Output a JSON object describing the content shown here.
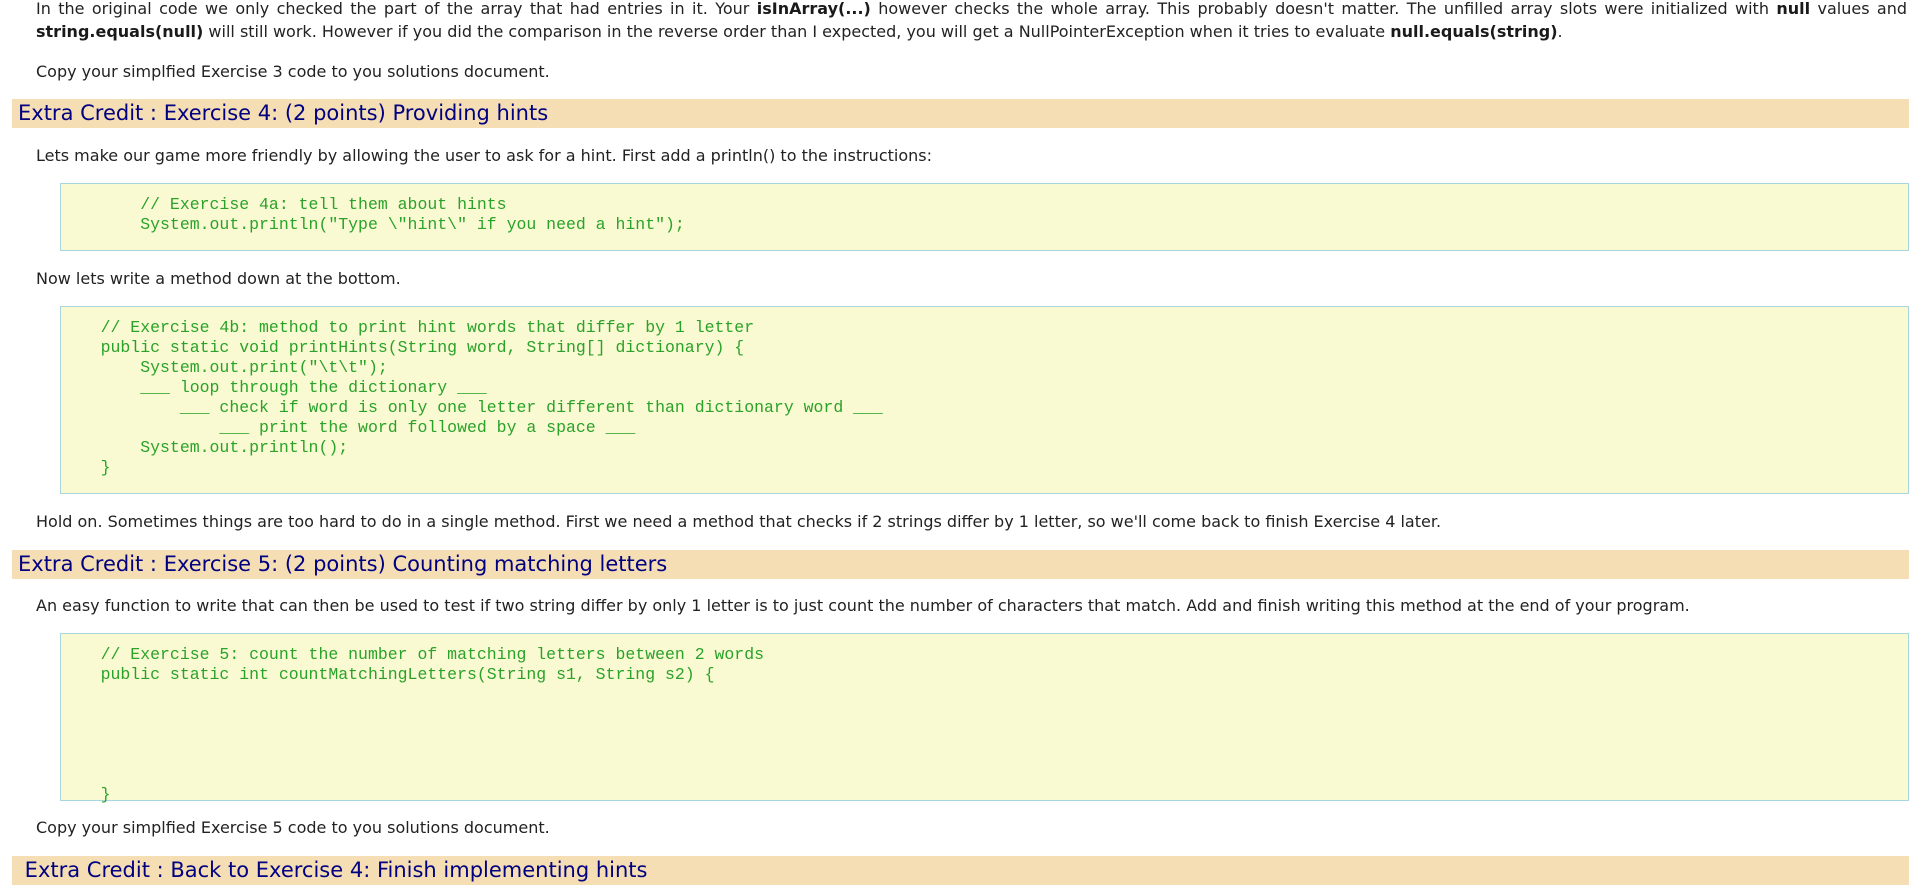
{
  "intro": {
    "p1_part1": "In the original code we only checked the part of the array that had entries in it. Your ",
    "p1_bold1": "isInArray(...)",
    "p1_part2": " however checks the whole array. This probably doesn't matter. The unfilled array slots were initialized with ",
    "p1_bold2": "null",
    "p1_part3": " values and ",
    "p1_bold3": "string.equals(null)",
    "p1_part4": " will still work. However if you did the comparison in the reverse order than I expected, you will get a NullPointerException when it tries to evaluate ",
    "p1_bold4": "null.equals(string)",
    "p1_part5": ".",
    "p2": "Copy your simplfied Exercise 3 code to you solutions document."
  },
  "exercise4": {
    "heading": "Extra Credit : Exercise 4: (2 points) Providing hints",
    "p1": "Lets make our game more friendly by allowing the user to ask for a hint. First add a println() to the instructions:",
    "code1": "        // Exercise 4a: tell them about hints\n        System.out.println(\"Type \\\"hint\\\" if you need a hint\");",
    "p2": "Now lets write a method down at the bottom.",
    "code2": "    // Exercise 4b: method to print hint words that differ by 1 letter\n    public static void printHints(String word, String[] dictionary) {\n        System.out.print(\"\\t\\t\");\n        ___ loop through the dictionary ___\n            ___ check if word is only one letter different than dictionary word ___\n                ___ print the word followed by a space ___\n        System.out.println();\n    }",
    "p3": "Hold on. Sometimes things are too hard to do in a single method. First we need a method that checks if 2 strings differ by 1 letter, so we'll come back to finish Exercise 4 later."
  },
  "exercise5": {
    "heading": "Extra Credit : Exercise 5: (2 points) Counting matching letters",
    "p1": "An easy function to write that can then be used to test if two string differ by only 1 letter is to just count the number of characters that match. Add and finish writing this method at the end of your program.",
    "code": "    // Exercise 5: count the number of matching letters between 2 words\n    public static int countMatchingLetters(String s1, String s2) {\n\n\n\n\n\n    }",
    "p2": "Copy your simplfied Exercise 5 code to you solutions document."
  },
  "back4": {
    "heading": " Extra Credit : Back to Exercise 4: Finish implementing hints"
  }
}
